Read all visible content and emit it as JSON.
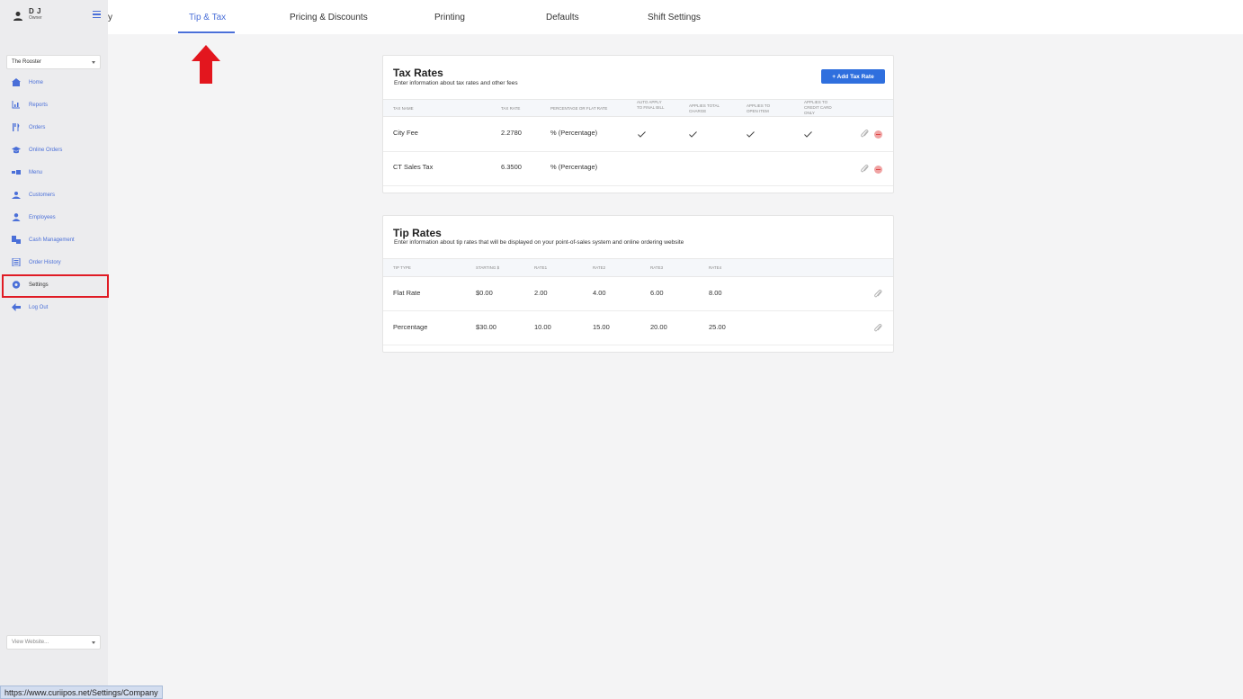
{
  "user": {
    "name": "D J",
    "role": "Owner"
  },
  "sidebar": {
    "store_select": "The Rooster",
    "items": [
      {
        "label": "Home",
        "icon": "home-icon"
      },
      {
        "label": "Reports",
        "icon": "bar-chart-icon"
      },
      {
        "label": "Orders",
        "icon": "cutlery-icon"
      },
      {
        "label": "Online Orders",
        "icon": "grad-cap-icon"
      },
      {
        "label": "Menu",
        "icon": "menu-book-icon"
      },
      {
        "label": "Customers",
        "icon": "customers-icon"
      },
      {
        "label": "Employees",
        "icon": "employee-icon"
      },
      {
        "label": "Cash Management",
        "icon": "cash-icon"
      },
      {
        "label": "Order History",
        "icon": "history-icon"
      },
      {
        "label": "Settings",
        "icon": "gear-icon"
      },
      {
        "label": "Log Out",
        "icon": "arrow-left-icon"
      }
    ],
    "website_select": "View Website...",
    "status_url": "https://www.curiipos.net/Settings/Company"
  },
  "tabs": {
    "partial": "y",
    "tip_tax": "Tip & Tax",
    "pricing": "Pricing & Discounts",
    "printing": "Printing",
    "defaults": "Defaults",
    "shift": "Shift Settings"
  },
  "tax_rates": {
    "title": "Tax Rates",
    "subtitle": "Enter information about tax rates and other fees",
    "add_button": "+ Add Tax Rate",
    "headers": {
      "tax_name": "TAX NAME",
      "tax_rate": "TAX RATE",
      "pct_flat": "PERCENTAGE OR FLAT RATE",
      "auto_apply": "AUTO APPLY TO FINAL BILL",
      "applies_total": "APPLIES TOTAL CHARGE",
      "applies_open": "APPLIES TO OPEN ITEM",
      "applies_credit": "APPLIES TO CREDIT CARD ONLY"
    },
    "rows": [
      {
        "name": "City Fee",
        "rate": "2.2780",
        "type": "% (Percentage)"
      },
      {
        "name": "CT Sales Tax",
        "rate": "6.3500",
        "type": "% (Percentage)"
      }
    ]
  },
  "tip_rates": {
    "title": "Tip Rates",
    "subtitle": "Enter information about tip rates that will be displayed on your point-of-sales system and online ordering website",
    "headers": {
      "tip_type": "TIP TYPE",
      "starting": "STARTING $",
      "rate1": "RATE1",
      "rate2": "RATE2",
      "rate3": "RATE3",
      "rate4": "RATE4"
    },
    "rows": [
      {
        "type": "Flat Rate",
        "starting": "$0.00",
        "r1": "2.00",
        "r2": "4.00",
        "r3": "6.00",
        "r4": "8.00"
      },
      {
        "type": "Percentage",
        "starting": "$30.00",
        "r1": "10.00",
        "r2": "15.00",
        "r3": "20.00",
        "r4": "25.00"
      }
    ]
  },
  "colors": {
    "accent": "#4a6fd8",
    "button": "#2f6fde",
    "highlight": "#e01b24"
  }
}
